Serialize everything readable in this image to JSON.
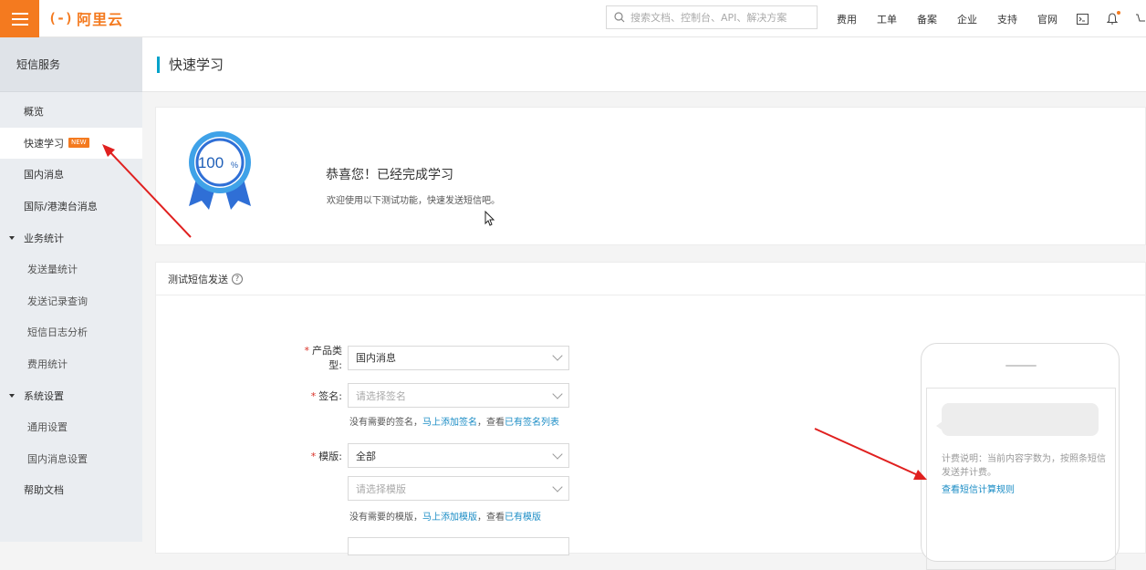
{
  "topbar": {
    "logo_mark": "(-)",
    "logo_name": "阿里云",
    "search_placeholder": "搜索文档、控制台、API、解决方案",
    "nav": [
      "费用",
      "工单",
      "备案",
      "企业",
      "支持",
      "官网"
    ],
    "accent": "#f47a1f"
  },
  "sidebar": {
    "header": "短信服务",
    "items": [
      {
        "label": "概览"
      },
      {
        "label": "快速学习",
        "badge": "NEW"
      },
      {
        "label": "国内消息"
      },
      {
        "label": "国际/港澳台消息"
      },
      {
        "label": "业务统计"
      },
      {
        "label": "发送量统计"
      },
      {
        "label": "发送记录查询"
      },
      {
        "label": "短信日志分析"
      },
      {
        "label": "费用统计"
      },
      {
        "label": "系统设置"
      },
      {
        "label": "通用设置"
      },
      {
        "label": "国内消息设置"
      },
      {
        "label": "帮助文档"
      }
    ]
  },
  "page": {
    "title": "快速学习",
    "medal_text": "100",
    "medal_unit": "%",
    "congrats": "恭喜您！已经完成学习",
    "welcome": "欢迎使用以下测试功能，快速发送短信吧。"
  },
  "test": {
    "title": "测试短信发送",
    "product_label": "产品类型:",
    "product_value": "国内消息",
    "sign_label": "签名:",
    "sign_placeholder": "请选择签名",
    "sign_hint_prefix": "没有需要的签名，",
    "sign_hint_link1": "马上添加签名",
    "sign_hint_mid": "，查看",
    "sign_hint_link2": "已有签名列表",
    "template_label": "模版:",
    "template_value": "全部",
    "template_placeholder": "请选择模版",
    "tpl_hint_prefix": "没有需要的模版，",
    "tpl_hint_link1": "马上添加模版",
    "tpl_hint_mid": "，查看",
    "tpl_hint_link2": "已有模版",
    "fee_note": "计费说明：当前内容字数为，按照条短信发送并计费。",
    "fee_link": "查看短信计算规则"
  }
}
